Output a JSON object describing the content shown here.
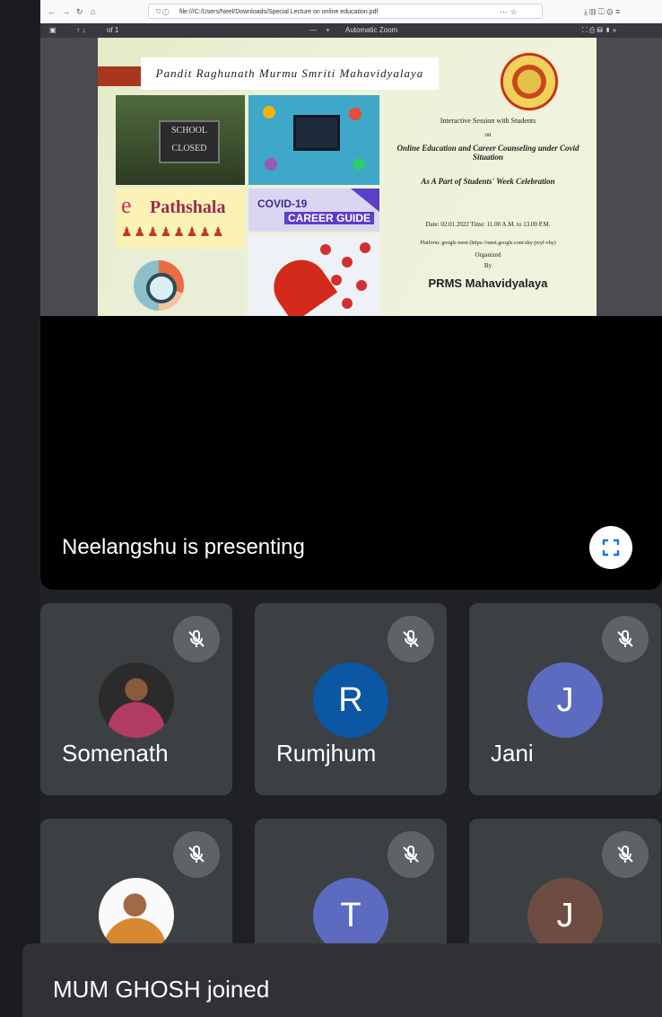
{
  "browser": {
    "url": "file:///C:/Users/Neel/Downloads/Special Lecture on online education.pdf",
    "zoom_label": "Automatic Zoom",
    "page_indicator": "of 1"
  },
  "poster": {
    "banner_text": "Pandit Raghunath Murmu Smriti Mahavidyalaya",
    "line1": "Interactive Session with Students",
    "line2": "on",
    "line3": "Online Education and Career Counseling under Covid Situation",
    "line4": "As A Part of Students' Week Celebration",
    "line5": "Date: 02.01.2022 Time: 11.00 A.M. to 13.00 P.M.",
    "line6": "Platform: google meet (https://meet.google.com/zky-jwyf-vhy)",
    "line7": "Organized",
    "line8": "By",
    "org": "PRMS Mahavidyalaya",
    "sign_text": "SCHOOL CLOSED",
    "epathshala_e": "e",
    "epathshala_text": "Pathshala",
    "covid_line1": "COVID-19",
    "covid_line2": "CAREER GUIDE"
  },
  "meeting": {
    "presenting_text": "Neelangshu is presenting",
    "participants": [
      {
        "name": "Somenath",
        "initial": "",
        "color": "#2b2b2b"
      },
      {
        "name": "Rumjhum",
        "initial": "R",
        "color": "#0b57a3"
      },
      {
        "name": "Jani",
        "initial": "J",
        "color": "#5c6bc0"
      },
      {
        "name": "",
        "initial": "",
        "color": "#ffffff"
      },
      {
        "name": "",
        "initial": "T",
        "color": "#5c6bc0"
      },
      {
        "name": "",
        "initial": "J",
        "color": "#6d4c41"
      }
    ],
    "toast": "MUM GHOSH joined"
  },
  "icons": {
    "mic": "mic-off-icon",
    "fullscreen": "fullscreen-icon"
  }
}
